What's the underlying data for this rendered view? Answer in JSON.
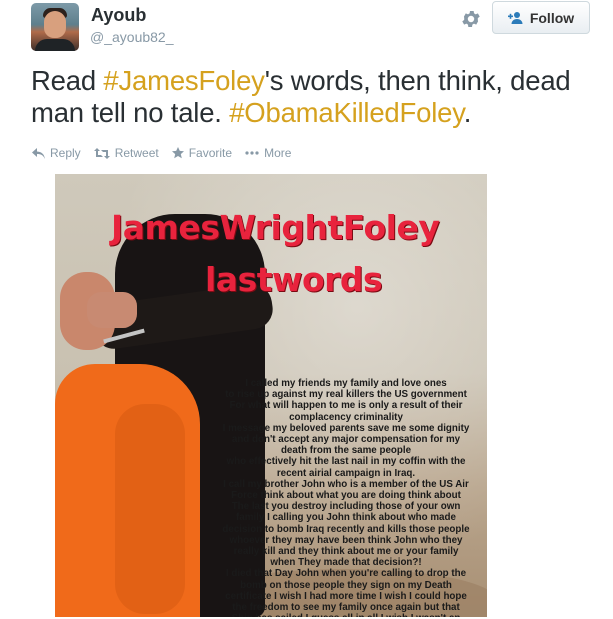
{
  "user": {
    "name": "Ayoub",
    "handle": "@_ayoub82_"
  },
  "header": {
    "follow_label": "Follow"
  },
  "tweet": {
    "part1": "Read ",
    "hashtag1": "#JamesFoley",
    "part2": "'s words, then think, dead man tell no tale. ",
    "hashtag2": "#ObamaKilledFoley",
    "part3": "."
  },
  "actions": {
    "reply": "Reply",
    "retweet": "Retweet",
    "favorite": "Favorite",
    "more": "More"
  },
  "media": {
    "title_line1": "JamesWrightFoley",
    "title_line2": "lastwords",
    "statement": "I called my friends my family and love ones\nto rise up against my real killers the US government\nFor what will happen to me is only a result of their\ncomplacency criminality\nI message my beloved parents save me some dignity\nand don't accept any major compensation for my\ndeath from the same people\nwho effectively hit the last nail in my coffin with the\nrecent airial campaign in Iraq.\nI call my brother John who is a member of the US Air\nForce think about what you are doing think about\nThe last you destroy including those of your own\nfamily I calling you John think about who made\ndecision to bomb Iraq recently and kills those people\nwhoever they may have been think John who they\nreally kill and they think about me or your family\nwhen They made that decision?!\nI died that Day John when you're calling to drop the\nbomb on those people they sign on my Death\ncertificate I wish I had more time I wish I could hope\nthe freedom to see my family once again but that\nShip has sailed I guess all in all I wish I wasn't an\nAmerican."
  },
  "colors": {
    "hashtag": "#d5a11e",
    "meta_gray": "#8899a6",
    "title_red": "#e8233d",
    "jumpsuit_orange": "#f06a1a"
  },
  "icons": {
    "reply": "reply-icon",
    "retweet": "retweet-icon",
    "favorite": "star-icon",
    "more": "ellipsis-icon",
    "settings": "gear-icon",
    "follow": "add-user-icon"
  }
}
